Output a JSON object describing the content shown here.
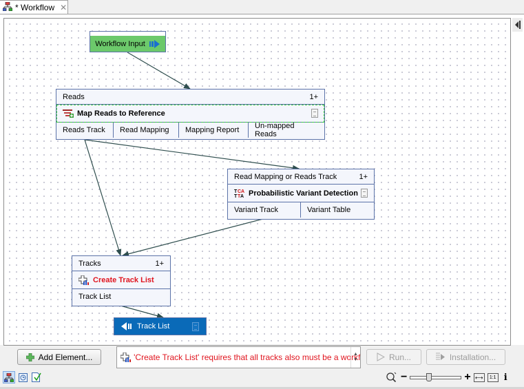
{
  "tab": {
    "title": "* Workflow",
    "icon": "workflow-icon",
    "close": "✕"
  },
  "nodes": {
    "workflow_input": {
      "label": "Workflow Input",
      "color": "#6cc96b"
    },
    "map_reads": {
      "input_label": "Reads",
      "multiplicity": "1+",
      "title": "Map Reads to Reference",
      "outputs": [
        "Reads Track",
        "Read Mapping",
        "Mapping Report",
        "Un-mapped Reads"
      ]
    },
    "variant_detection": {
      "input_label": "Read Mapping or Reads Track",
      "multiplicity": "1+",
      "title": "Probabilistic Variant Detection",
      "outputs": [
        "Variant Track",
        "Variant Table"
      ]
    },
    "create_track_list": {
      "input_label": "Tracks",
      "multiplicity": "1+",
      "title": "Create Track List",
      "title_color": "#e0141e",
      "outputs": [
        "Track List"
      ]
    },
    "track_list_output": {
      "label": "Track List",
      "color": "#0a6ab8"
    }
  },
  "bottom": {
    "add_element": "Add Element...",
    "message": "'Create Track List' requires that all tracks also must be a workflow",
    "run": "Run...",
    "installation": "Installation...",
    "zoom_minus": "−",
    "zoom_plus": "+",
    "zoom_level": 0.35,
    "fit": "⟷",
    "one_to_one": "1:1",
    "info": "i"
  }
}
